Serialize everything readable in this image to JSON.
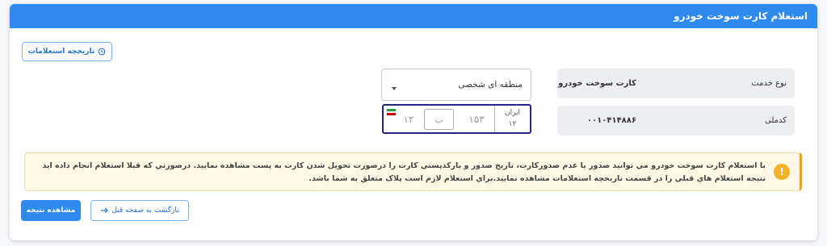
{
  "header": {
    "title": "استعلام کارت سوخت خودرو"
  },
  "toolbar": {
    "history_label": "تاریخچه استعلامات",
    "history_icon": "history-icon"
  },
  "service": {
    "label": "نوع خدمت",
    "value": "کارت سوخت خودرو"
  },
  "code": {
    "label": "کدملی",
    "value": "۰۰۱۰۴۱۴۸۸۶"
  },
  "region_select": {
    "selected": "منطقه ای شخصی"
  },
  "plate": {
    "country_label": "ایران",
    "region_code": "۱۲",
    "three_digit": "۱۵۳",
    "letter": "ب",
    "two_digit": "۱۲"
  },
  "alert": {
    "icon": "warning-icon",
    "text": "با استعلام کارت سوخت خودرو مي توانيد صدور يا عدم صدورکارت، تاريخ صدور و بارکدپستي کارت را درصورت تحويل شدن کارت به پست مشاهده نماييد. درصورتي که قبلا استعلام انجام داده ايد نتيجه استعلام هاي قبلي را در قسمت تاريخچه استعلامات مشاهده نماييد.براي استعلام لازم است پلاک متعلق به شما باشد."
  },
  "actions": {
    "view_result": "مشاهده نتیجه",
    "back": "بازگشت به صفحه قبل"
  },
  "colors": {
    "primary": "#2f8af0",
    "plate_border": "#262680",
    "alert_bg": "#fff8e5",
    "alert_icon": "#f3b229"
  }
}
